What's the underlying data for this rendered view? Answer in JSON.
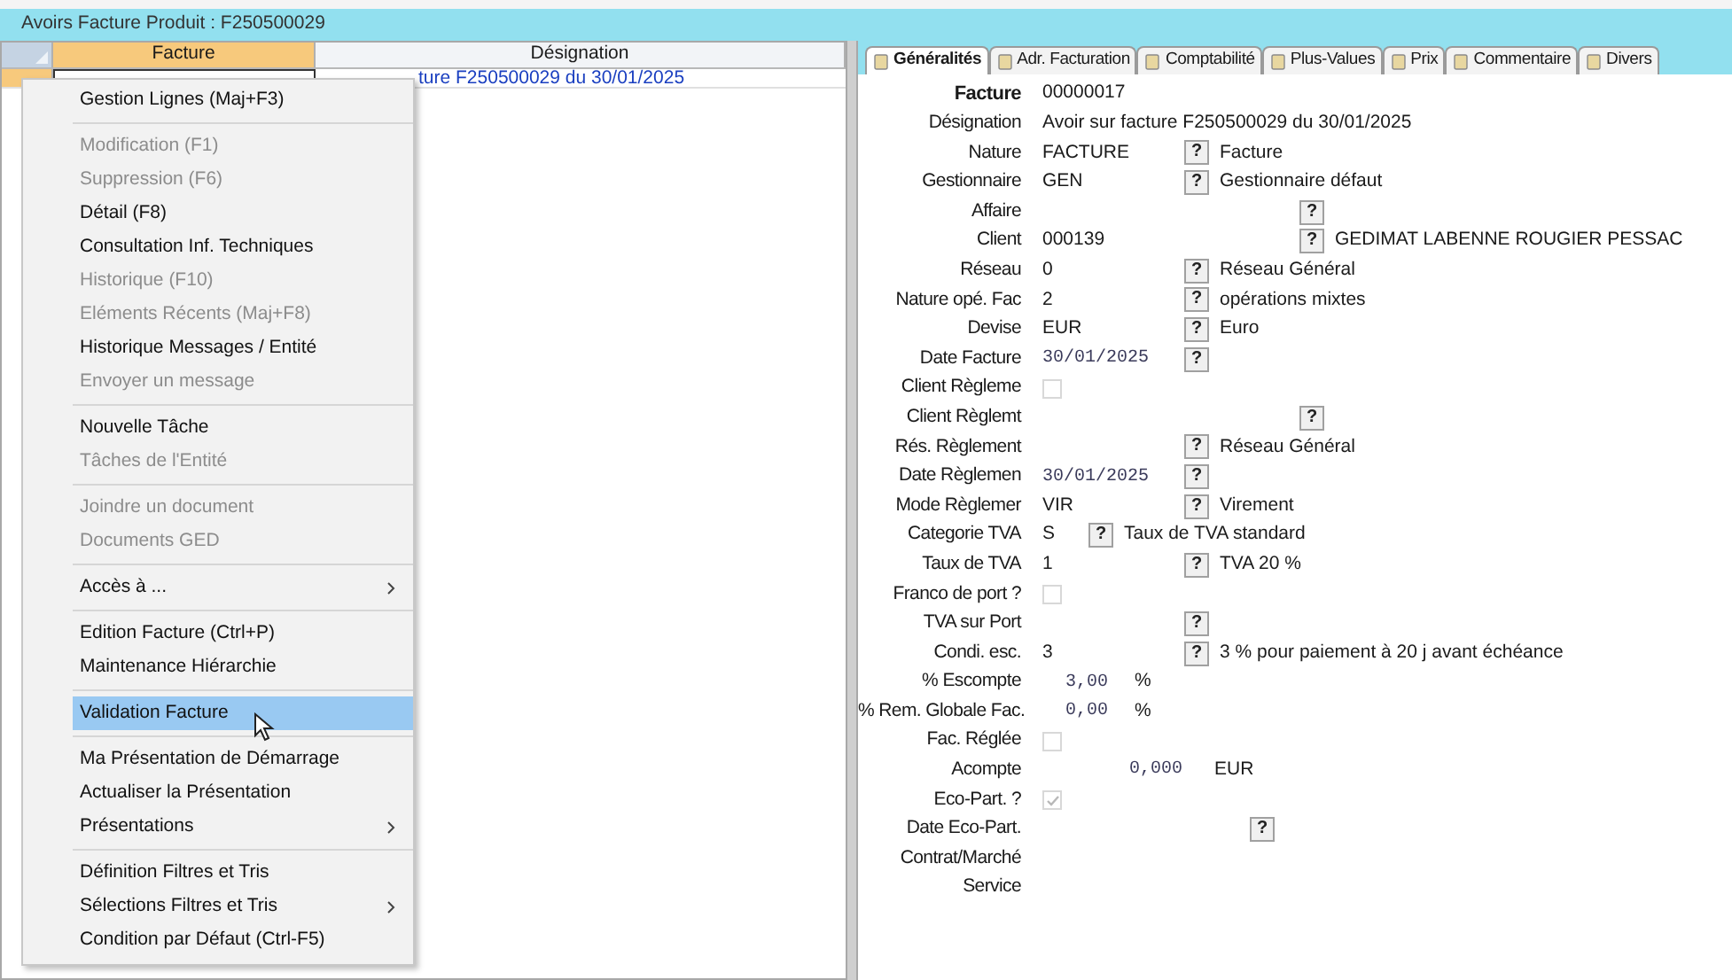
{
  "window": {
    "title": "Avoirs Facture Produit : F250500029"
  },
  "grid": {
    "columns": [
      {
        "label": "Facture",
        "selected": true
      },
      {
        "label": "Désignation",
        "selected": false
      }
    ],
    "rows": [
      {
        "selected": true,
        "cells": [
          "",
          "ture F250500029 du 30/01/2025"
        ]
      }
    ]
  },
  "context_menu": {
    "groups": [
      [
        {
          "label": "Gestion Lignes (Maj+F3)",
          "disabled": false,
          "selected": false,
          "submenu": false
        }
      ],
      [
        {
          "label": "Modification (F1)",
          "disabled": true,
          "selected": false,
          "submenu": false
        },
        {
          "label": "Suppression (F6)",
          "disabled": true,
          "selected": false,
          "submenu": false
        },
        {
          "label": "Détail (F8)",
          "disabled": false,
          "selected": false,
          "submenu": false
        },
        {
          "label": "Consultation Inf. Techniques",
          "disabled": false,
          "selected": false,
          "submenu": false
        },
        {
          "label": "Historique (F10)",
          "disabled": true,
          "selected": false,
          "submenu": false
        },
        {
          "label": "Eléments Récents (Maj+F8)",
          "disabled": true,
          "selected": false,
          "submenu": false
        },
        {
          "label": "Historique Messages / Entité",
          "disabled": false,
          "selected": false,
          "submenu": false
        },
        {
          "label": "Envoyer un message",
          "disabled": true,
          "selected": false,
          "submenu": false
        }
      ],
      [
        {
          "label": "Nouvelle Tâche",
          "disabled": false,
          "selected": false,
          "submenu": false
        },
        {
          "label": "Tâches de l'Entité",
          "disabled": true,
          "selected": false,
          "submenu": false
        }
      ],
      [
        {
          "label": "Joindre un document",
          "disabled": true,
          "selected": false,
          "submenu": false
        },
        {
          "label": "Documents GED",
          "disabled": true,
          "selected": false,
          "submenu": false
        }
      ],
      [
        {
          "label": "Accès à ...",
          "disabled": false,
          "selected": false,
          "submenu": true
        }
      ],
      [
        {
          "label": "Edition Facture (Ctrl+P)",
          "disabled": false,
          "selected": false,
          "submenu": false
        },
        {
          "label": "Maintenance Hiérarchie",
          "disabled": false,
          "selected": false,
          "submenu": false
        }
      ],
      [
        {
          "label": "Validation Facture",
          "disabled": false,
          "selected": true,
          "submenu": false
        }
      ],
      [
        {
          "label": "Ma Présentation de Démarrage",
          "disabled": false,
          "selected": false,
          "submenu": false
        },
        {
          "label": "Actualiser la Présentation",
          "disabled": false,
          "selected": false,
          "submenu": false
        },
        {
          "label": "Présentations",
          "disabled": false,
          "selected": false,
          "submenu": true
        }
      ],
      [
        {
          "label": "Définition Filtres et Tris",
          "disabled": false,
          "selected": false,
          "submenu": false
        },
        {
          "label": "Sélections Filtres et Tris",
          "disabled": false,
          "selected": false,
          "submenu": true
        },
        {
          "label": "Condition par Défaut (Ctrl-F5)",
          "disabled": false,
          "selected": false,
          "submenu": false
        }
      ]
    ]
  },
  "tabs": [
    {
      "label": "Généralités",
      "selected": true
    },
    {
      "label": "Adr. Facturation",
      "selected": false
    },
    {
      "label": "Comptabilité",
      "selected": false
    },
    {
      "label": "Plus-Values",
      "selected": false
    },
    {
      "label": "Prix",
      "selected": false
    },
    {
      "label": "Commentaire",
      "selected": false
    },
    {
      "label": "Divers",
      "selected": false
    }
  ],
  "form": [
    {
      "kind": "plain",
      "label": "Facture",
      "value": "00000017"
    },
    {
      "kind": "plain",
      "label": "Désignation",
      "value": "Avoir sur facture F250500029 du 30/01/2025"
    },
    {
      "kind": "lookup",
      "label": "Nature",
      "value": "FACTURE",
      "button": "?",
      "description": "Facture"
    },
    {
      "kind": "lookup",
      "label": "Gestionnaire",
      "value": "GEN",
      "button": "?",
      "description": "Gestionnaire défaut"
    },
    {
      "kind": "widelookup",
      "label": "Affaire",
      "button": "?"
    },
    {
      "kind": "widelookup",
      "label": "Client",
      "value": "000139",
      "button": "?",
      "description": "GEDIMAT LABENNE ROUGIER PESSAC"
    },
    {
      "kind": "lookup",
      "label": "Réseau",
      "value": "0",
      "button": "?",
      "description": "Réseau Général"
    },
    {
      "kind": "lookup",
      "label": "Nature opé. Fac",
      "value": "2",
      "button": "?",
      "description": "opérations mixtes"
    },
    {
      "kind": "lookup",
      "label": "Devise",
      "value": "EUR",
      "button": "?",
      "description": "Euro"
    },
    {
      "kind": "date",
      "label": "Date Facture",
      "value": "30/01/2025",
      "button": "?"
    },
    {
      "kind": "checkbox",
      "label": "Client Règleme",
      "checked": false
    },
    {
      "kind": "widelookup",
      "label": "Client Règlemt",
      "button": "?"
    },
    {
      "kind": "lookup",
      "label": "Rés. Règlement",
      "button": "?",
      "description": "Réseau Général"
    },
    {
      "kind": "date",
      "label": "Date Règlemen",
      "value": "30/01/2025",
      "button": "?"
    },
    {
      "kind": "lookup",
      "label": "Mode Règlemer",
      "value": "VIR",
      "button": "?",
      "description": "Virement"
    },
    {
      "kind": "narrowlookup",
      "label": "Categorie TVA",
      "value": "S",
      "button": "?",
      "description": "Taux de TVA standard"
    },
    {
      "kind": "lookup",
      "label": "Taux de TVA",
      "value": "1",
      "button": "?",
      "description": "TVA 20 %"
    },
    {
      "kind": "checkbox",
      "label": "Franco de port ?",
      "checked": false
    },
    {
      "kind": "lookup",
      "label": "TVA sur Port",
      "button": "?"
    },
    {
      "kind": "lookup",
      "label": "Condi. esc.",
      "value": "3",
      "button": "?",
      "description": "3 % pour paiement à 20 j avant échéance"
    },
    {
      "kind": "number",
      "label": "% Escompte",
      "value": "3,00",
      "unit": "%"
    },
    {
      "kind": "number",
      "label": "% Rem. Globale Fac.",
      "value": "0,00",
      "unit": "%"
    },
    {
      "kind": "checkbox",
      "label": "Fac. Réglée",
      "checked": false
    },
    {
      "kind": "amount",
      "label": "Acompte",
      "value": "0,000",
      "unit": "EUR"
    },
    {
      "kind": "checkbox",
      "label": "Eco-Part. ?",
      "checked": true
    },
    {
      "kind": "ecodate",
      "label": "Date Eco-Part.",
      "button": "?"
    },
    {
      "kind": "plain",
      "label": "Contrat/Marché"
    },
    {
      "kind": "plain",
      "label": "Service"
    }
  ]
}
